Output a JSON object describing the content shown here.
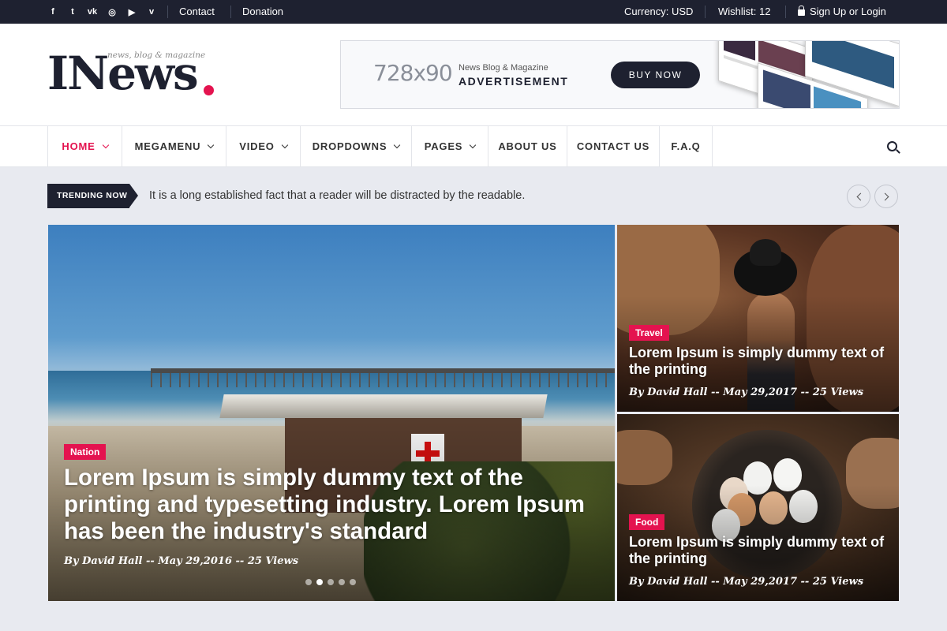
{
  "topbar": {
    "social": [
      {
        "name": "facebook-icon",
        "glyph": "f"
      },
      {
        "name": "twitter-icon",
        "glyph": "t"
      },
      {
        "name": "vk-icon",
        "glyph": "vk"
      },
      {
        "name": "instagram-icon",
        "glyph": "◎"
      },
      {
        "name": "youtube-icon",
        "glyph": "▶"
      },
      {
        "name": "vimeo-icon",
        "glyph": "v"
      }
    ],
    "contact": "Contact",
    "donation": "Donation",
    "currency": "Currency: USD",
    "wishlist": "Wishlist: 12",
    "signup": "Sign Up or Login"
  },
  "logo": {
    "text": "INews",
    "tagline": "news, blog & magazine",
    "accent": "#e4134f"
  },
  "ad": {
    "size": "728x90",
    "subtitle": "News Blog & Magazine",
    "title": "ADVERTISEMENT",
    "button": "BUY NOW"
  },
  "nav": {
    "items": [
      "HOME",
      "MEGAMENU",
      "VIDEO",
      "DROPDOWNS",
      "PAGES",
      "ABOUT US",
      "CONTACT US",
      "F.A.Q"
    ],
    "active": "HOME"
  },
  "trending": {
    "label": "TRENDING NOW",
    "text": "It is a long established fact that a reader will be distracted by the readable."
  },
  "feature": {
    "category": "Nation",
    "headline": "Lorem Ipsum is simply dummy text of the printing and typesetting industry. Lorem Ipsum has been the industry's standard",
    "meta": "By David Hall -- May 29,2016 -- 25 Views",
    "slides": 5,
    "active_slide": 2
  },
  "side_posts": [
    {
      "category": "Travel",
      "headline": "Lorem Ipsum is simply dummy text of the printing",
      "meta": "By David Hall -- May 29,2017 -- 25 Views"
    },
    {
      "category": "Food",
      "headline": "Lorem Ipsum is simply dummy text of the printing",
      "meta": "By David Hall -- May 29,2017 -- 25 Views"
    }
  ],
  "colors": {
    "dark": "#1e2130",
    "accent": "#e4134f",
    "background": "#e8eaf0"
  }
}
